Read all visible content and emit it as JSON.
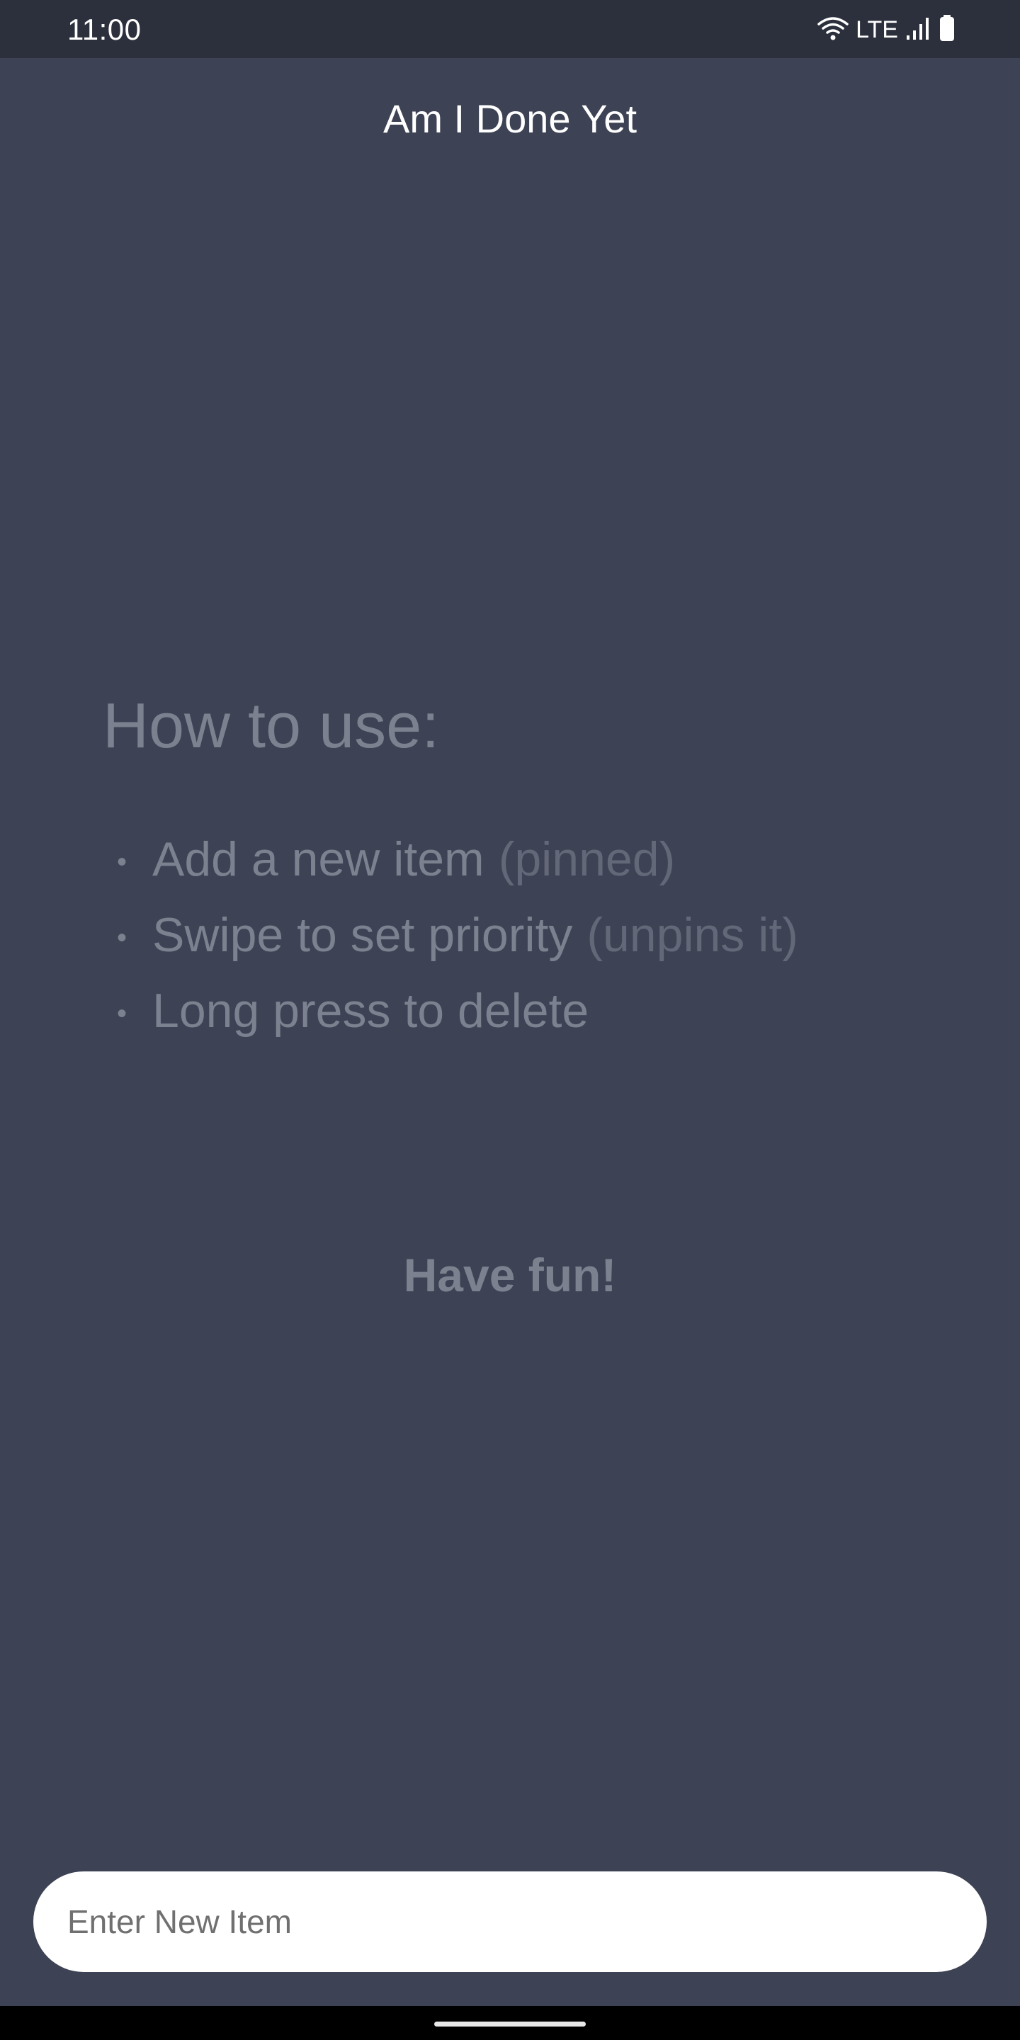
{
  "status_bar": {
    "time": "11:00",
    "network_label": "LTE",
    "icons": [
      "wifi-icon",
      "signal-icon",
      "battery-icon"
    ]
  },
  "app": {
    "title": "Am I Done Yet"
  },
  "instructions": {
    "heading": "How to use:",
    "items": [
      {
        "text": "Add a new item",
        "note": "(pinned)"
      },
      {
        "text": "Swipe to set priority",
        "note": "(unpins it)"
      },
      {
        "text": "Long press to delete",
        "note": ""
      }
    ],
    "closing": "Have fun!"
  },
  "new_item": {
    "placeholder": "Enter New Item",
    "value": ""
  },
  "colors": {
    "background": "#3d4254",
    "status_bar": "#2c303c",
    "muted_text": "#7c8190",
    "note_text": "#636878",
    "input_background": "#ffffff"
  }
}
